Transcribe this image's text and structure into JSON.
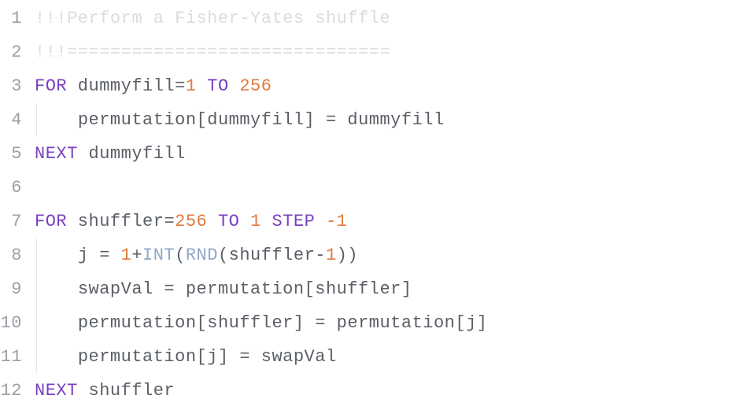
{
  "editor": {
    "lines": [
      {
        "num": "1",
        "indent": 0,
        "tokens": [
          {
            "cls": "tok-comment",
            "text": "!!!Perform a Fisher-Yates shuffle"
          }
        ]
      },
      {
        "num": "2",
        "indent": 0,
        "tokens": [
          {
            "cls": "tok-comment",
            "text": "!!!=============================="
          }
        ]
      },
      {
        "num": "3",
        "indent": 0,
        "tokens": [
          {
            "cls": "tok-keyword",
            "text": "FOR"
          },
          {
            "cls": "tok-ident",
            "text": " dummyfill"
          },
          {
            "cls": "tok-op",
            "text": "="
          },
          {
            "cls": "tok-number",
            "text": "1"
          },
          {
            "cls": "tok-keyword",
            "text": " TO "
          },
          {
            "cls": "tok-number",
            "text": "256"
          }
        ]
      },
      {
        "num": "4",
        "indent": 1,
        "tokens": [
          {
            "cls": "tok-ident",
            "text": "permutation[dummyfill] = dummyfill"
          }
        ]
      },
      {
        "num": "5",
        "indent": 0,
        "tokens": [
          {
            "cls": "tok-keyword",
            "text": "NEXT"
          },
          {
            "cls": "tok-ident",
            "text": " dummyfill"
          }
        ]
      },
      {
        "num": "6",
        "indent": 0,
        "tokens": []
      },
      {
        "num": "7",
        "indent": 0,
        "tokens": [
          {
            "cls": "tok-keyword",
            "text": "FOR"
          },
          {
            "cls": "tok-ident",
            "text": " shuffler"
          },
          {
            "cls": "tok-op",
            "text": "="
          },
          {
            "cls": "tok-number",
            "text": "256"
          },
          {
            "cls": "tok-keyword",
            "text": " TO "
          },
          {
            "cls": "tok-number",
            "text": "1"
          },
          {
            "cls": "tok-keyword",
            "text": " STEP "
          },
          {
            "cls": "tok-number",
            "text": "-1"
          }
        ]
      },
      {
        "num": "8",
        "indent": 1,
        "tokens": [
          {
            "cls": "tok-ident",
            "text": "j = "
          },
          {
            "cls": "tok-number",
            "text": "1"
          },
          {
            "cls": "tok-op",
            "text": "+"
          },
          {
            "cls": "tok-func",
            "text": "INT"
          },
          {
            "cls": "tok-op",
            "text": "("
          },
          {
            "cls": "tok-func",
            "text": "RND"
          },
          {
            "cls": "tok-op",
            "text": "("
          },
          {
            "cls": "tok-ident",
            "text": "shuffler"
          },
          {
            "cls": "tok-op",
            "text": "-"
          },
          {
            "cls": "tok-number",
            "text": "1"
          },
          {
            "cls": "tok-op",
            "text": "))"
          }
        ]
      },
      {
        "num": "9",
        "indent": 1,
        "tokens": [
          {
            "cls": "tok-ident",
            "text": "swapVal = permutation[shuffler]"
          }
        ]
      },
      {
        "num": "10",
        "indent": 1,
        "tokens": [
          {
            "cls": "tok-ident",
            "text": "permutation[shuffler] = permutation[j]"
          }
        ]
      },
      {
        "num": "11",
        "indent": 1,
        "tokens": [
          {
            "cls": "tok-ident",
            "text": "permutation[j] = swapVal"
          }
        ]
      },
      {
        "num": "12",
        "indent": 0,
        "tokens": [
          {
            "cls": "tok-keyword",
            "text": "NEXT"
          },
          {
            "cls": "tok-ident",
            "text": " shuffler"
          }
        ]
      }
    ],
    "indent_text": "    "
  }
}
